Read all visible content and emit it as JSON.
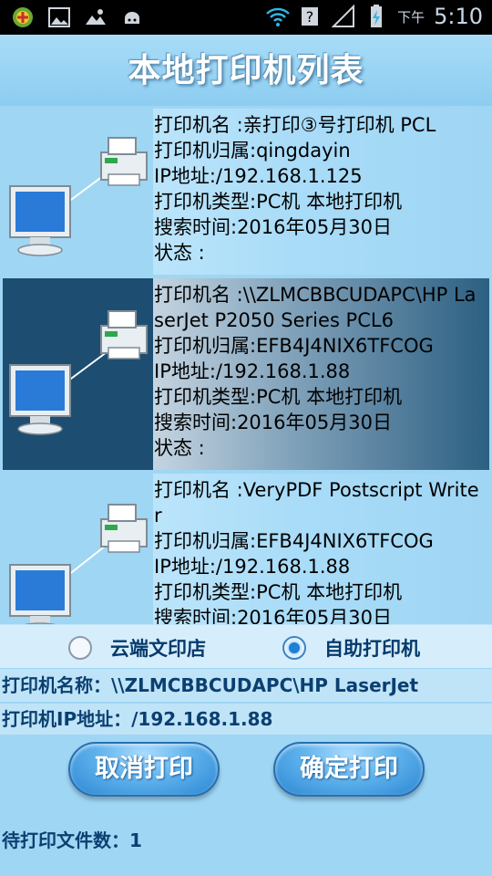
{
  "status_bar": {
    "left_icons": [
      "app-notification-icon",
      "image-icon",
      "cloud-icon",
      "android-icon"
    ],
    "right_icons": [
      "wifi-icon",
      "signal-icon",
      "battery-charging-icon"
    ],
    "ampm": "下午",
    "time": "5:10"
  },
  "header": {
    "title": "本地打印机列表"
  },
  "printers": [
    {
      "name": "打印机名 :亲打印③号打印机 PCL",
      "owner": "打印机归属:qingdayin",
      "ip": "IP地址:/192.168.1.125",
      "type": "打印机类型:PC机 本地打印机",
      "time": "搜索时间:2016年05月30日",
      "status": "状态 :",
      "selected": false
    },
    {
      "name": "打印机名 :\\\\ZLMCBBCUDAPC\\HP LaserJet P2050 Series PCL6",
      "owner": "打印机归属:EFB4J4NIX6TFCOG",
      "ip": "IP地址:/192.168.1.88",
      "type": "打印机类型:PC机 本地打印机",
      "time": "搜索时间:2016年05月30日",
      "status": "状态 :",
      "selected": true
    },
    {
      "name": "打印机名 :VeryPDF Postscript Writer",
      "owner": "打印机归属:EFB4J4NIX6TFCOG",
      "ip": "IP地址:/192.168.1.88",
      "type": "打印机类型:PC机 本地打印机",
      "time": "搜索时间:2016年05月30日"
    }
  ],
  "mode": {
    "options": [
      "云端文印店",
      "自助打印机"
    ],
    "selected_index": 1
  },
  "selected_printer": {
    "name_line": "打印机名称：\\\\ZLMCBBCUDAPC\\HP LaserJet",
    "ip_line": "打印机IP地址：/192.168.1.88"
  },
  "buttons": {
    "cancel": "取消打印",
    "confirm": "确定打印"
  },
  "footer": {
    "pending": "待打印文件数：1"
  },
  "colors": {
    "background": "#9fd6f4",
    "selected_row": "#1d4e72",
    "button": "#3f97dd",
    "text_dark_blue": "#0b3f70"
  }
}
